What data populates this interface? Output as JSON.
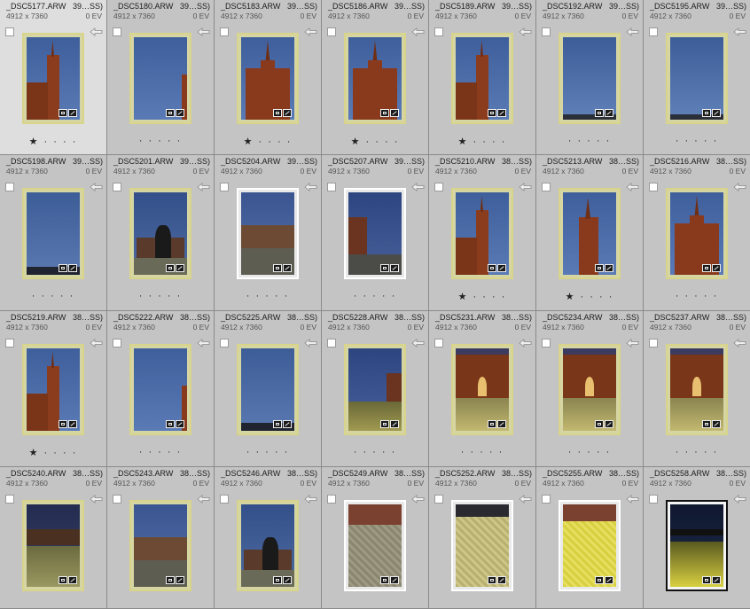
{
  "colors": {
    "cell_bg": "#c4c4c4",
    "cell_selected_bg": "#dedede",
    "thumb_border_yellow": "#d8d48a",
    "sky_blue": "#4a6aa8",
    "brick": "#8a3a1c",
    "cobble_yellow": "#c8c060"
  },
  "cells": [
    {
      "name": "_DSC5177.ARW",
      "suffix": "39…SS)",
      "dims": "4912 x 7360",
      "ev": "0 EV",
      "rating": "★ · · · ·",
      "scene": "tower-left",
      "selected": true
    },
    {
      "name": "_DSC5180.ARW",
      "suffix": "39…SS)",
      "dims": "4912 x 7360",
      "ev": "0 EV",
      "rating": "· · · · ·",
      "scene": "sky-edge"
    },
    {
      "name": "_DSC5183.ARW",
      "suffix": "39…SS)",
      "dims": "4912 x 7360",
      "ev": "0 EV",
      "rating": "★ · · · ·",
      "scene": "church-full"
    },
    {
      "name": "_DSC5186.ARW",
      "suffix": "39…SS)",
      "dims": "4912 x 7360",
      "ev": "0 EV",
      "rating": "★ · · · ·",
      "scene": "church-full"
    },
    {
      "name": "_DSC5189.ARW",
      "suffix": "39…SS)",
      "dims": "4912 x 7360",
      "ev": "0 EV",
      "rating": "★ · · · ·",
      "scene": "tower-left"
    },
    {
      "name": "_DSC5192.ARW",
      "suffix": "39…SS)",
      "dims": "4912 x 7360",
      "ev": "0 EV",
      "rating": "· · · · ·",
      "scene": "sky-only"
    },
    {
      "name": "_DSC5195.ARW",
      "suffix": "39…SS)",
      "dims": "4912 x 7360",
      "ev": "0 EV",
      "rating": "· · · · ·",
      "scene": "sky-only"
    },
    {
      "name": "_DSC5198.ARW",
      "suffix": "39…SS)",
      "dims": "4912 x 7360",
      "ev": "0 EV",
      "rating": "· · · · ·",
      "scene": "sky-trees"
    },
    {
      "name": "_DSC5201.ARW",
      "suffix": "39…SS)",
      "dims": "4912 x 7360",
      "ev": "0 EV",
      "rating": "· · · · ·",
      "scene": "tree-building"
    },
    {
      "name": "_DSC5204.ARW",
      "suffix": "39…SS)",
      "dims": "4912 x 7360",
      "ev": "0 EV",
      "rating": "· · · · ·",
      "scene": "building-plaza",
      "border": "none"
    },
    {
      "name": "_DSC5207.ARW",
      "suffix": "39…SS)",
      "dims": "4912 x 7360",
      "ev": "0 EV",
      "rating": "· · · · ·",
      "scene": "plaza-church",
      "border": "none"
    },
    {
      "name": "_DSC5210.ARW",
      "suffix": "38…SS)",
      "dims": "4912 x 7360",
      "ev": "0 EV",
      "rating": "★ · · · ·",
      "scene": "tower-left"
    },
    {
      "name": "_DSC5213.ARW",
      "suffix": "38…SS)",
      "dims": "4912 x 7360",
      "ev": "0 EV",
      "rating": "★ · · · ·",
      "scene": "tower-center"
    },
    {
      "name": "_DSC5216.ARW",
      "suffix": "38…SS)",
      "dims": "4912 x 7360",
      "ev": "0 EV",
      "rating": "· · · · ·",
      "scene": "church-full"
    },
    {
      "name": "_DSC5219.ARW",
      "suffix": "38…SS)",
      "dims": "4912 x 7360",
      "ev": "0 EV",
      "rating": "★ · · · ·",
      "scene": "tower-left"
    },
    {
      "name": "_DSC5222.ARW",
      "suffix": "38…SS)",
      "dims": "4912 x 7360",
      "ev": "0 EV",
      "rating": "· · · · ·",
      "scene": "sky-edge"
    },
    {
      "name": "_DSC5225.ARW",
      "suffix": "38…SS)",
      "dims": "4912 x 7360",
      "ev": "0 EV",
      "rating": "· · · · ·",
      "scene": "sky-trees"
    },
    {
      "name": "_DSC5228.ARW",
      "suffix": "38…SS)",
      "dims": "4912 x 7360",
      "ev": "0 EV",
      "rating": "· · · · ·",
      "scene": "plaza-dusk"
    },
    {
      "name": "_DSC5231.ARW",
      "suffix": "38…SS)",
      "dims": "4912 x 7360",
      "ev": "0 EV",
      "rating": "· · · · ·",
      "scene": "church-door"
    },
    {
      "name": "_DSC5234.ARW",
      "suffix": "38…SS)",
      "dims": "4912 x 7360",
      "ev": "0 EV",
      "rating": "· · · · ·",
      "scene": "church-door"
    },
    {
      "name": "_DSC5237.ARW",
      "suffix": "38…SS)",
      "dims": "4912 x 7360",
      "ev": "0 EV",
      "rating": "· · · · ·",
      "scene": "church-door"
    },
    {
      "name": "_DSC5240.ARW",
      "suffix": "38…SS)",
      "dims": "4912 x 7360",
      "ev": "0 EV",
      "rating": "",
      "scene": "plaza-night"
    },
    {
      "name": "_DSC5243.ARW",
      "suffix": "38…SS)",
      "dims": "4912 x 7360",
      "ev": "0 EV",
      "rating": "",
      "scene": "building-plaza"
    },
    {
      "name": "_DSC5246.ARW",
      "suffix": "38…SS)",
      "dims": "4912 x 7360",
      "ev": "0 EV",
      "rating": "",
      "scene": "tree-building"
    },
    {
      "name": "_DSC5249.ARW",
      "suffix": "38…SS)",
      "dims": "4912 x 7360",
      "ev": "0 EV",
      "rating": "",
      "scene": "cobble",
      "border": "none"
    },
    {
      "name": "_DSC5252.ARW",
      "suffix": "38…SS)",
      "dims": "4912 x 7360",
      "ev": "0 EV",
      "rating": "",
      "scene": "cobble-light",
      "border": "none"
    },
    {
      "name": "_DSC5255.ARW",
      "suffix": "38…SS)",
      "dims": "4912 x 7360",
      "ev": "0 EV",
      "rating": "",
      "scene": "cobble-yellow",
      "border": "none"
    },
    {
      "name": "_DSC5258.ARW",
      "suffix": "38…SS)",
      "dims": "4912 x 7360",
      "ev": "0 EV",
      "rating": "",
      "scene": "night-yellow",
      "border": "black"
    }
  ]
}
